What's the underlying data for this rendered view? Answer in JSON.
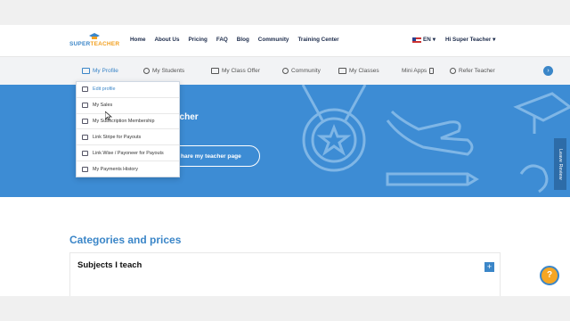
{
  "logo": {
    "part1": "SUPER",
    "part2": "TEACHER"
  },
  "mainnav": [
    "Home",
    "About Us",
    "Pricing",
    "FAQ",
    "Blog",
    "Community",
    "Training Center"
  ],
  "lang": "EN",
  "user_menu": "Hi Super Teacher",
  "subnav": [
    {
      "label": "My Profile",
      "icon": "profile-icon"
    },
    {
      "label": "My Students",
      "icon": "students-icon"
    },
    {
      "label": "My Class Offer",
      "icon": "class-offer-icon"
    },
    {
      "label": "Community",
      "icon": "community-icon"
    },
    {
      "label": "My Classes",
      "icon": "calendar-icon"
    },
    {
      "label": "Mini Apps",
      "icon": "mini-apps-icon"
    },
    {
      "label": "Refer Teacher",
      "icon": "refer-icon"
    }
  ],
  "dropdown": [
    "Edit profile",
    "My Sales",
    "My Subscription Membership",
    "Link Stripe for Payouts",
    "Link Wise / Payoneer for Payouts",
    "My Payments History"
  ],
  "hero": {
    "title": "acher",
    "share_label": "hare my teacher page",
    "review_tab": "Leave Review"
  },
  "section": {
    "title": "Categories and prices",
    "card_heading": "Subjects I teach",
    "plus": "+"
  },
  "help": "?",
  "colors": {
    "accent": "#3b86c8",
    "hero": "#3d8cd4",
    "help": "#f5a623"
  }
}
